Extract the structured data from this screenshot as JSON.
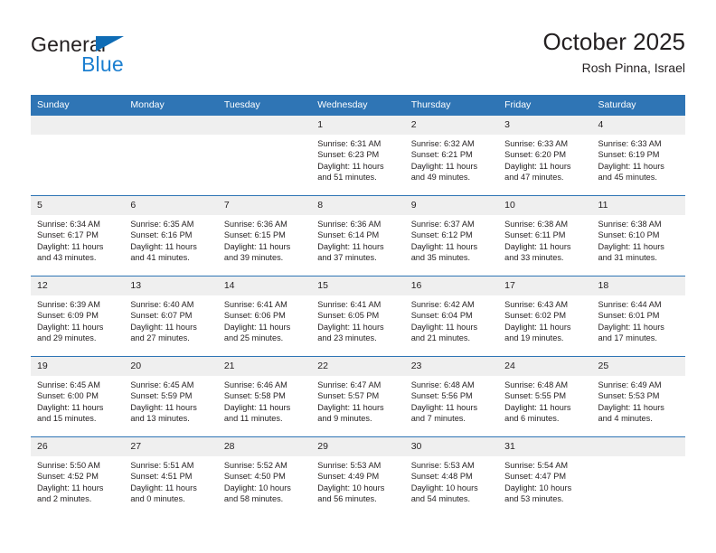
{
  "brand": {
    "line1": "General",
    "line2": "Blue",
    "triangle_icon": "triangle-icon",
    "color_dark": "#231f20",
    "color_blue": "#1c7fd0"
  },
  "header": {
    "title": "October 2025",
    "subtitle": "Rosh Pinna, Israel"
  },
  "theme": {
    "header_blue": "#2f75b5",
    "daynum_gray": "#efefef",
    "text": "#231f20"
  },
  "calendar": {
    "weekday_headers": [
      "Sunday",
      "Monday",
      "Tuesday",
      "Wednesday",
      "Thursday",
      "Friday",
      "Saturday"
    ],
    "weeks": [
      [
        {
          "day": "",
          "lines": []
        },
        {
          "day": "",
          "lines": []
        },
        {
          "day": "",
          "lines": []
        },
        {
          "day": "1",
          "lines": [
            "Sunrise: 6:31 AM",
            "Sunset: 6:23 PM",
            "Daylight: 11 hours",
            "and 51 minutes."
          ]
        },
        {
          "day": "2",
          "lines": [
            "Sunrise: 6:32 AM",
            "Sunset: 6:21 PM",
            "Daylight: 11 hours",
            "and 49 minutes."
          ]
        },
        {
          "day": "3",
          "lines": [
            "Sunrise: 6:33 AM",
            "Sunset: 6:20 PM",
            "Daylight: 11 hours",
            "and 47 minutes."
          ]
        },
        {
          "day": "4",
          "lines": [
            "Sunrise: 6:33 AM",
            "Sunset: 6:19 PM",
            "Daylight: 11 hours",
            "and 45 minutes."
          ]
        }
      ],
      [
        {
          "day": "5",
          "lines": [
            "Sunrise: 6:34 AM",
            "Sunset: 6:17 PM",
            "Daylight: 11 hours",
            "and 43 minutes."
          ]
        },
        {
          "day": "6",
          "lines": [
            "Sunrise: 6:35 AM",
            "Sunset: 6:16 PM",
            "Daylight: 11 hours",
            "and 41 minutes."
          ]
        },
        {
          "day": "7",
          "lines": [
            "Sunrise: 6:36 AM",
            "Sunset: 6:15 PM",
            "Daylight: 11 hours",
            "and 39 minutes."
          ]
        },
        {
          "day": "8",
          "lines": [
            "Sunrise: 6:36 AM",
            "Sunset: 6:14 PM",
            "Daylight: 11 hours",
            "and 37 minutes."
          ]
        },
        {
          "day": "9",
          "lines": [
            "Sunrise: 6:37 AM",
            "Sunset: 6:12 PM",
            "Daylight: 11 hours",
            "and 35 minutes."
          ]
        },
        {
          "day": "10",
          "lines": [
            "Sunrise: 6:38 AM",
            "Sunset: 6:11 PM",
            "Daylight: 11 hours",
            "and 33 minutes."
          ]
        },
        {
          "day": "11",
          "lines": [
            "Sunrise: 6:38 AM",
            "Sunset: 6:10 PM",
            "Daylight: 11 hours",
            "and 31 minutes."
          ]
        }
      ],
      [
        {
          "day": "12",
          "lines": [
            "Sunrise: 6:39 AM",
            "Sunset: 6:09 PM",
            "Daylight: 11 hours",
            "and 29 minutes."
          ]
        },
        {
          "day": "13",
          "lines": [
            "Sunrise: 6:40 AM",
            "Sunset: 6:07 PM",
            "Daylight: 11 hours",
            "and 27 minutes."
          ]
        },
        {
          "day": "14",
          "lines": [
            "Sunrise: 6:41 AM",
            "Sunset: 6:06 PM",
            "Daylight: 11 hours",
            "and 25 minutes."
          ]
        },
        {
          "day": "15",
          "lines": [
            "Sunrise: 6:41 AM",
            "Sunset: 6:05 PM",
            "Daylight: 11 hours",
            "and 23 minutes."
          ]
        },
        {
          "day": "16",
          "lines": [
            "Sunrise: 6:42 AM",
            "Sunset: 6:04 PM",
            "Daylight: 11 hours",
            "and 21 minutes."
          ]
        },
        {
          "day": "17",
          "lines": [
            "Sunrise: 6:43 AM",
            "Sunset: 6:02 PM",
            "Daylight: 11 hours",
            "and 19 minutes."
          ]
        },
        {
          "day": "18",
          "lines": [
            "Sunrise: 6:44 AM",
            "Sunset: 6:01 PM",
            "Daylight: 11 hours",
            "and 17 minutes."
          ]
        }
      ],
      [
        {
          "day": "19",
          "lines": [
            "Sunrise: 6:45 AM",
            "Sunset: 6:00 PM",
            "Daylight: 11 hours",
            "and 15 minutes."
          ]
        },
        {
          "day": "20",
          "lines": [
            "Sunrise: 6:45 AM",
            "Sunset: 5:59 PM",
            "Daylight: 11 hours",
            "and 13 minutes."
          ]
        },
        {
          "day": "21",
          "lines": [
            "Sunrise: 6:46 AM",
            "Sunset: 5:58 PM",
            "Daylight: 11 hours",
            "and 11 minutes."
          ]
        },
        {
          "day": "22",
          "lines": [
            "Sunrise: 6:47 AM",
            "Sunset: 5:57 PM",
            "Daylight: 11 hours",
            "and 9 minutes."
          ]
        },
        {
          "day": "23",
          "lines": [
            "Sunrise: 6:48 AM",
            "Sunset: 5:56 PM",
            "Daylight: 11 hours",
            "and 7 minutes."
          ]
        },
        {
          "day": "24",
          "lines": [
            "Sunrise: 6:48 AM",
            "Sunset: 5:55 PM",
            "Daylight: 11 hours",
            "and 6 minutes."
          ]
        },
        {
          "day": "25",
          "lines": [
            "Sunrise: 6:49 AM",
            "Sunset: 5:53 PM",
            "Daylight: 11 hours",
            "and 4 minutes."
          ]
        }
      ],
      [
        {
          "day": "26",
          "lines": [
            "Sunrise: 5:50 AM",
            "Sunset: 4:52 PM",
            "Daylight: 11 hours",
            "and 2 minutes."
          ]
        },
        {
          "day": "27",
          "lines": [
            "Sunrise: 5:51 AM",
            "Sunset: 4:51 PM",
            "Daylight: 11 hours",
            "and 0 minutes."
          ]
        },
        {
          "day": "28",
          "lines": [
            "Sunrise: 5:52 AM",
            "Sunset: 4:50 PM",
            "Daylight: 10 hours",
            "and 58 minutes."
          ]
        },
        {
          "day": "29",
          "lines": [
            "Sunrise: 5:53 AM",
            "Sunset: 4:49 PM",
            "Daylight: 10 hours",
            "and 56 minutes."
          ]
        },
        {
          "day": "30",
          "lines": [
            "Sunrise: 5:53 AM",
            "Sunset: 4:48 PM",
            "Daylight: 10 hours",
            "and 54 minutes."
          ]
        },
        {
          "day": "31",
          "lines": [
            "Sunrise: 5:54 AM",
            "Sunset: 4:47 PM",
            "Daylight: 10 hours",
            "and 53 minutes."
          ]
        },
        {
          "day": "",
          "lines": []
        }
      ]
    ]
  }
}
